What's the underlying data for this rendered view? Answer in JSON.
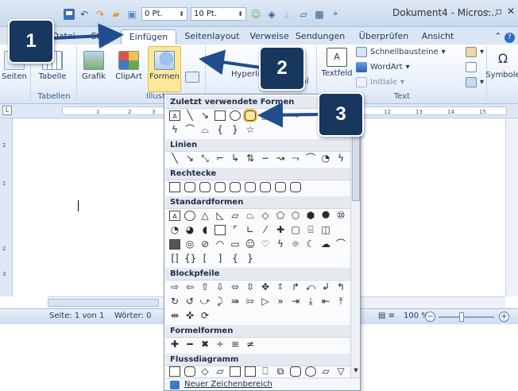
{
  "titlebar": {
    "font_size_combo_1": "0 Pt.",
    "font_size_combo_2": "10 Pt.",
    "window_title": "Dokument4 - Micros..."
  },
  "tabs": [
    {
      "label": "Datei"
    },
    {
      "label": "Start"
    },
    {
      "label": "Einfügen"
    },
    {
      "label": "Seitenlayout"
    },
    {
      "label": "Verweise"
    },
    {
      "label": "Sendungen"
    },
    {
      "label": "Überprüfen"
    },
    {
      "label": "Ansicht"
    }
  ],
  "ribbon": {
    "seiten_label": "Seiten",
    "tabelle_label": "Tabelle",
    "grafik_label": "Grafik",
    "clipart_label": "ClipArt",
    "formen_label": "Formen",
    "hyperlink_label": "Hyperlin",
    "textfeld_label": "Textfeld",
    "schnellbausteine_label": "Schnellbausteine",
    "wordart_label": "WordArt",
    "initiale_label": "Initiale",
    "symbole_label": "Symbole",
    "header_fragment_label": "le",
    "footer_fragment_label": "e",
    "pagenum_fragment_label": "zahl",
    "group_tabellen": "Tabellen",
    "group_illustrationen": "Illustra",
    "group_text": "Text"
  },
  "shapes_menu": {
    "section_recent": "Zuletzt verwendete Formen",
    "section_lines": "Linien",
    "section_rect": "Rechtecke",
    "section_standard": "Standardformen",
    "section_block": "Blockpfeile",
    "section_formula": "Formelformen",
    "section_flow": "Flussdiagramm",
    "footer_label": "Neuer Zeichenbereich"
  },
  "ruler": {
    "ticks": [
      "1",
      "2",
      "3",
      "12",
      "13",
      "14",
      "15"
    ]
  },
  "statusbar": {
    "page": "Seite: 1 von 1",
    "words": "Wörter: 0",
    "zoom": "100 %"
  },
  "callouts": {
    "one": "1",
    "two": "2",
    "three": "3"
  },
  "colors": {
    "callout_bg": "#17375e",
    "arrow": "#1f4e8c",
    "ribbon_active_bg": "#fde89a"
  }
}
